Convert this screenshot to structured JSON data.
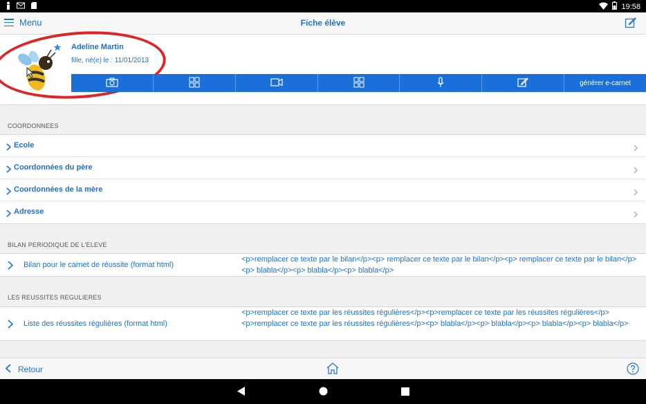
{
  "status_bar": {
    "time": "19:58",
    "icons": [
      "person-icon",
      "mail-icon",
      "sd-card-icon",
      "wifi-icon",
      "battery-icon"
    ]
  },
  "nav": {
    "menu_label": "Menu",
    "title": "Fiche élève"
  },
  "student": {
    "name": "Adeline Martin",
    "subtitle": "fille, né(e) le : 11/01/2013"
  },
  "toolbar": {
    "buttons": [
      "camera-icon",
      "grid-icon",
      "video-icon",
      "grid-icon",
      "microphone-icon",
      "edit-icon"
    ],
    "ecarnet_label": "générer e-carnet"
  },
  "sections": {
    "coordonnees": {
      "title": "COORDONNEES",
      "items": [
        "Ecole",
        "Coordonnées du père",
        "Coordonnées de la mère",
        "Adresse"
      ]
    },
    "bilan": {
      "title": "BILAN PERIODIQUE DE L'ELEVE",
      "label": "Bilan pour le carnet de réussite (format html)",
      "value": "<p>remplacer ce texte par le bilan</p><p> remplacer ce texte par le bilan</p><p> remplacer ce texte par le bilan</p><p> blabla</p><p> blabla</p><p> blabla</p>"
    },
    "reussites": {
      "title": "LES REUSSITES REGULIERES",
      "label": "Liste des réussites régulières (format html)",
      "value": "<p>remplacer ce texte par les réussites régulières</p><p>remplacer ce texte par les réussites régulières</p><p>remplacer ce texte par les réussites régulières</p><p> blabla</p><p> blabla</p><p> blabla</p><p> blabla</p>"
    }
  },
  "bottom": {
    "back_label": "Retour"
  },
  "colors": {
    "accent": "#1a6fd8",
    "highlight_ring": "#e02424",
    "background": "#f0f0f2"
  }
}
